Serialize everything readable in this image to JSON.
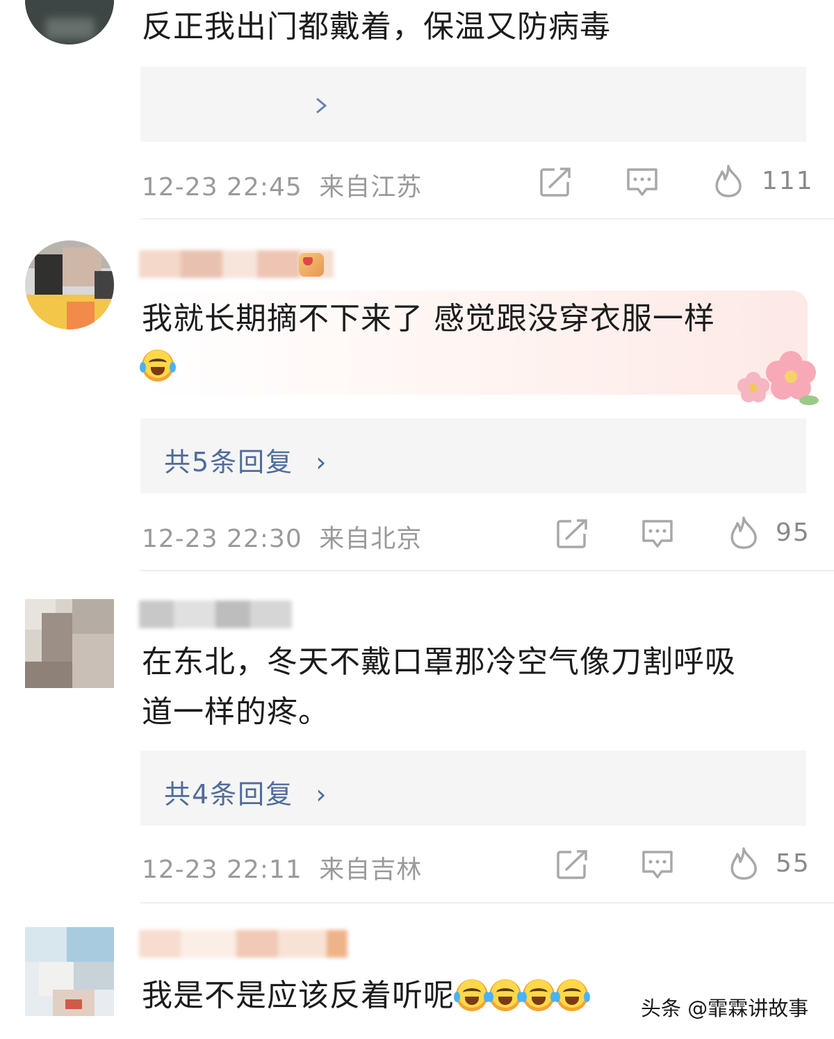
{
  "comments": [
    {
      "text": "反正我出门都戴着，保温又防病毒",
      "datetime": "12-23 22:45",
      "location": "来自江苏",
      "likes": "111",
      "has_arrow_image": true
    },
    {
      "text_line1": "我就长期摘不下来了 感觉跟没穿衣服一样",
      "emoji": "laugh-cry-emoji",
      "reply_label": "共5条回复",
      "reply_chevron": "›",
      "datetime": "12-23 22:30",
      "location": "来自北京",
      "likes": "95"
    },
    {
      "text_line1": "在东北，冬天不戴口罩那冷空气像刀割呼吸",
      "text_line2": "道一样的疼。",
      "reply_label": "共4条回复",
      "reply_chevron": "›",
      "datetime": "12-23 22:11",
      "location": "来自吉林",
      "likes": "55"
    },
    {
      "text": "我是不是应该反着听呢",
      "emoji": "laugh-cry-emoji",
      "emoji_count": 4
    }
  ],
  "icons": {
    "share": "share-icon",
    "comment": "comment-icon",
    "like": "fire-like-icon"
  },
  "watermark": "头条 @霏霖讲故事",
  "colors": {
    "reply_link": "#4f6c9a",
    "meta": "#9a9a9a",
    "box_bg": "#f5f5f5",
    "icon_stroke": "#a8a8a8"
  }
}
